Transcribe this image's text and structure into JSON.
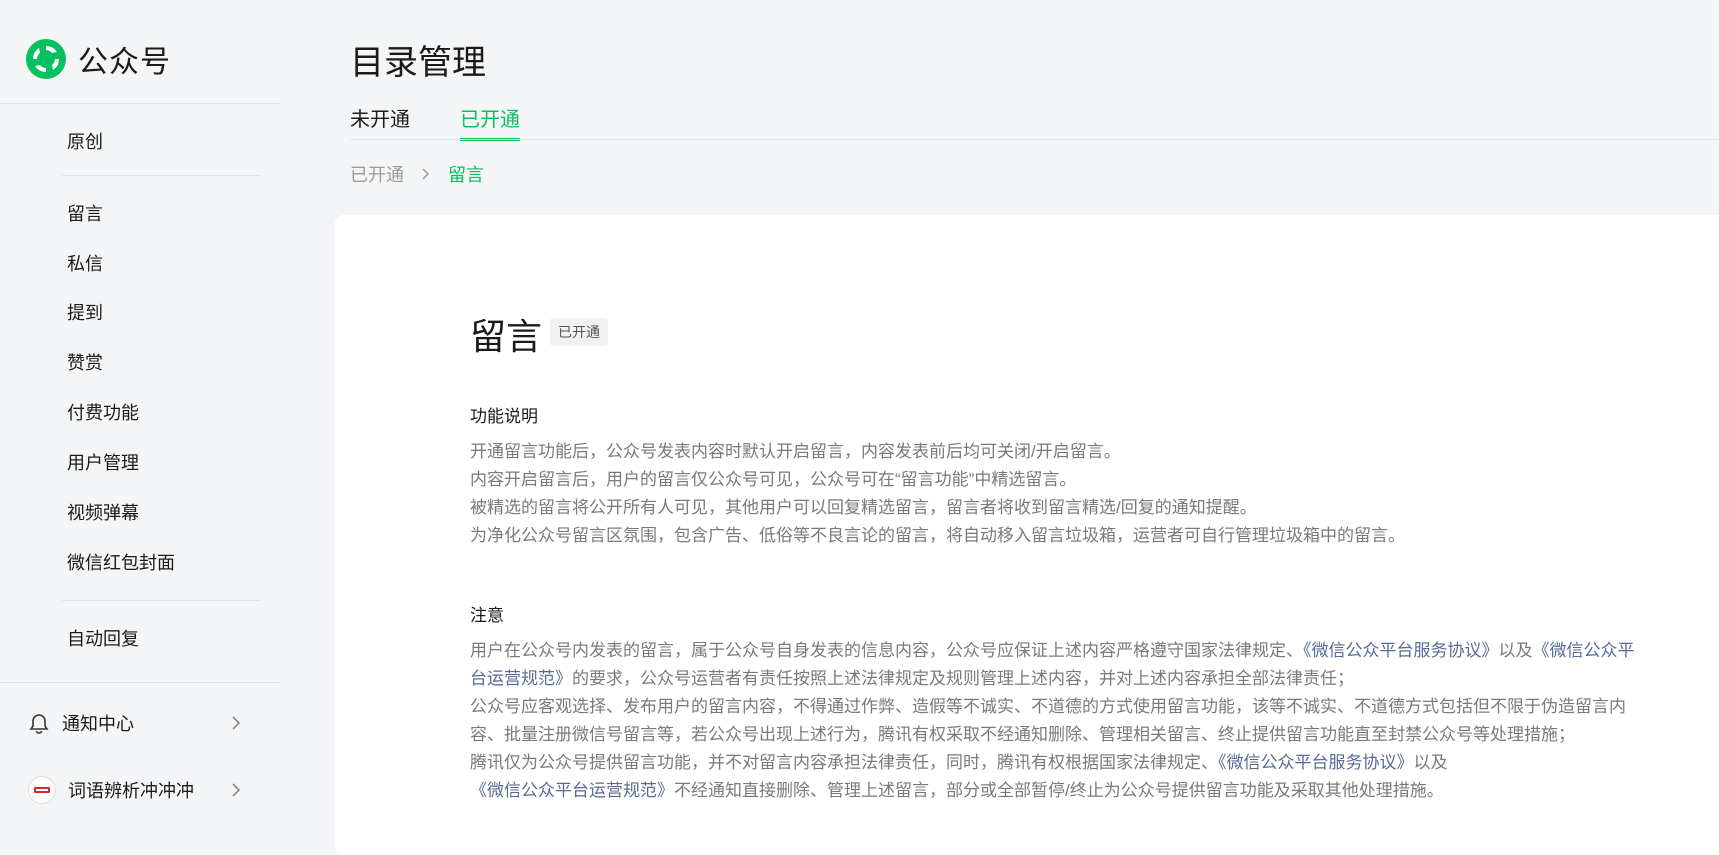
{
  "brand": {
    "name": "公众号",
    "accent": "#07c160"
  },
  "sidebar": {
    "items": [
      {
        "label": "原创"
      },
      {
        "label": "留言"
      },
      {
        "label": "私信"
      },
      {
        "label": "提到"
      },
      {
        "label": "赞赏"
      },
      {
        "label": "付费功能"
      },
      {
        "label": "用户管理"
      },
      {
        "label": "视频弹幕"
      },
      {
        "label": "微信红包封面"
      },
      {
        "label": "自动回复"
      }
    ],
    "notification": {
      "label": "通知中心",
      "icon": "bell-icon"
    },
    "account": {
      "label": "词语辨析冲冲冲"
    }
  },
  "header": {
    "title": "目录管理",
    "tabs": [
      {
        "label": "未开通"
      },
      {
        "label": "已开通"
      }
    ],
    "active_tab": "已开通"
  },
  "breadcrumb": {
    "root": "已开通",
    "current": "留言"
  },
  "content": {
    "title": "留言",
    "badge": "已开通",
    "feature_heading": "功能说明",
    "feature_paragraphs": [
      "开通留言功能后，公众号发表内容时默认开启留言，内容发表前后均可关闭/开启留言。",
      "内容开启留言后，用户的留言仅公众号可见，公众号可在“留言功能”中精选留言。",
      "被精选的留言将公开所有人可见，其他用户可以回复精选留言，留言者将收到留言精选/回复的通知提醒。",
      "为净化公众号留言区氛围，包含广告、低俗等不良言论的留言，将自动移入留言垃圾箱，运营者可自行管理垃圾箱中的留言。"
    ],
    "note_heading": "注意",
    "note1": {
      "a": "用户在公众号内发表的留言，属于公众号自身发表的信息内容，公众号应保证上述内容严格遵守国家法律规定、",
      "link1": "《微信公众平台服务协议》",
      "b": "以及",
      "link2": "《微信公众平台运营规范》",
      "c": "的要求，公众号运营者有责任按照上述法律规定及规则管理上述内容，并对上述内容承担全部法律责任；"
    },
    "note2": "公众号应客观选择、发布用户的留言内容，不得通过作弊、造假等不诚实、不道德的方式使用留言功能，该等不诚实、不道德方式包括但不限于伪造留言内容、批量注册微信号留言等，若公众号出现上述行为，腾讯有权采取不经通知删除、管理相关留言、终止提供留言功能直至封禁公众号等处理措施；",
    "note3": {
      "a": "腾讯仅为公众号提供留言功能，并不对留言内容承担法律责任，同时，腾讯有权根据国家法律规定、",
      "link1": "《微信公众平台服务协议》",
      "b": "以及",
      "link2": "《微信公众平台运营规范》",
      "c": "不经通知直接删除、管理上述留言，部分或全部暂停/终止为公众号提供留言功能及采取其他处理措施。"
    }
  }
}
